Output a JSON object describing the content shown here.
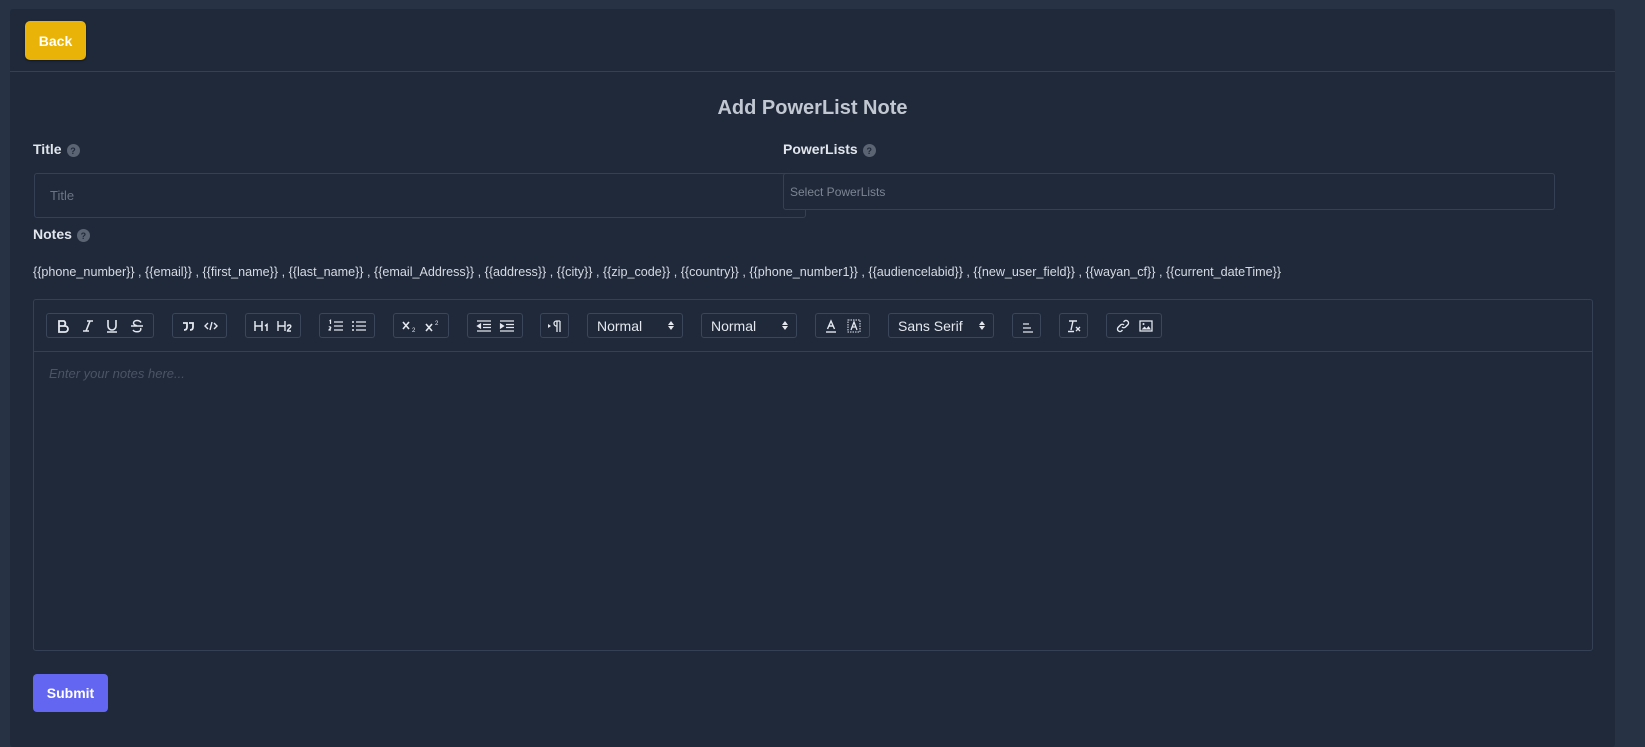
{
  "header": {
    "back_label": "Back"
  },
  "form": {
    "title": "Add PowerList Note",
    "title_field": {
      "label": "Title",
      "placeholder": "Title",
      "value": ""
    },
    "powerlists_field": {
      "label": "PowerLists",
      "placeholder": "Select PowerLists"
    },
    "notes_field": {
      "label": "Notes",
      "variables": "{{phone_number}} , {{email}} , {{first_name}} , {{last_name}} , {{email_Address}} , {{address}} , {{city}} , {{zip_code}} , {{country}} , {{phone_number1}} , {{audiencelabid}} , {{new_user_field}} , {{wayan_cf}} , {{current_dateTime}}",
      "placeholder": "Enter your notes here..."
    },
    "help_glyph": "?",
    "submit_label": "Submit"
  },
  "toolbar": {
    "size_select": "Normal",
    "header_select": "Normal",
    "font_select": "Sans Serif",
    "icons": [
      "bold-icon",
      "italic-icon",
      "underline-icon",
      "strike-icon",
      "blockquote-icon",
      "code-block-icon",
      "h1-icon",
      "h2-icon",
      "ordered-list-icon",
      "bullet-list-icon",
      "subscript-icon",
      "superscript-icon",
      "outdent-icon",
      "indent-icon",
      "text-direction-icon",
      "font-color-icon",
      "background-color-icon",
      "align-icon",
      "clean-format-icon",
      "link-icon",
      "image-icon"
    ]
  },
  "colors": {
    "background": "#273244",
    "card": "#1f293a",
    "back_button": "#eab308",
    "submit_button": "#6366f1"
  }
}
